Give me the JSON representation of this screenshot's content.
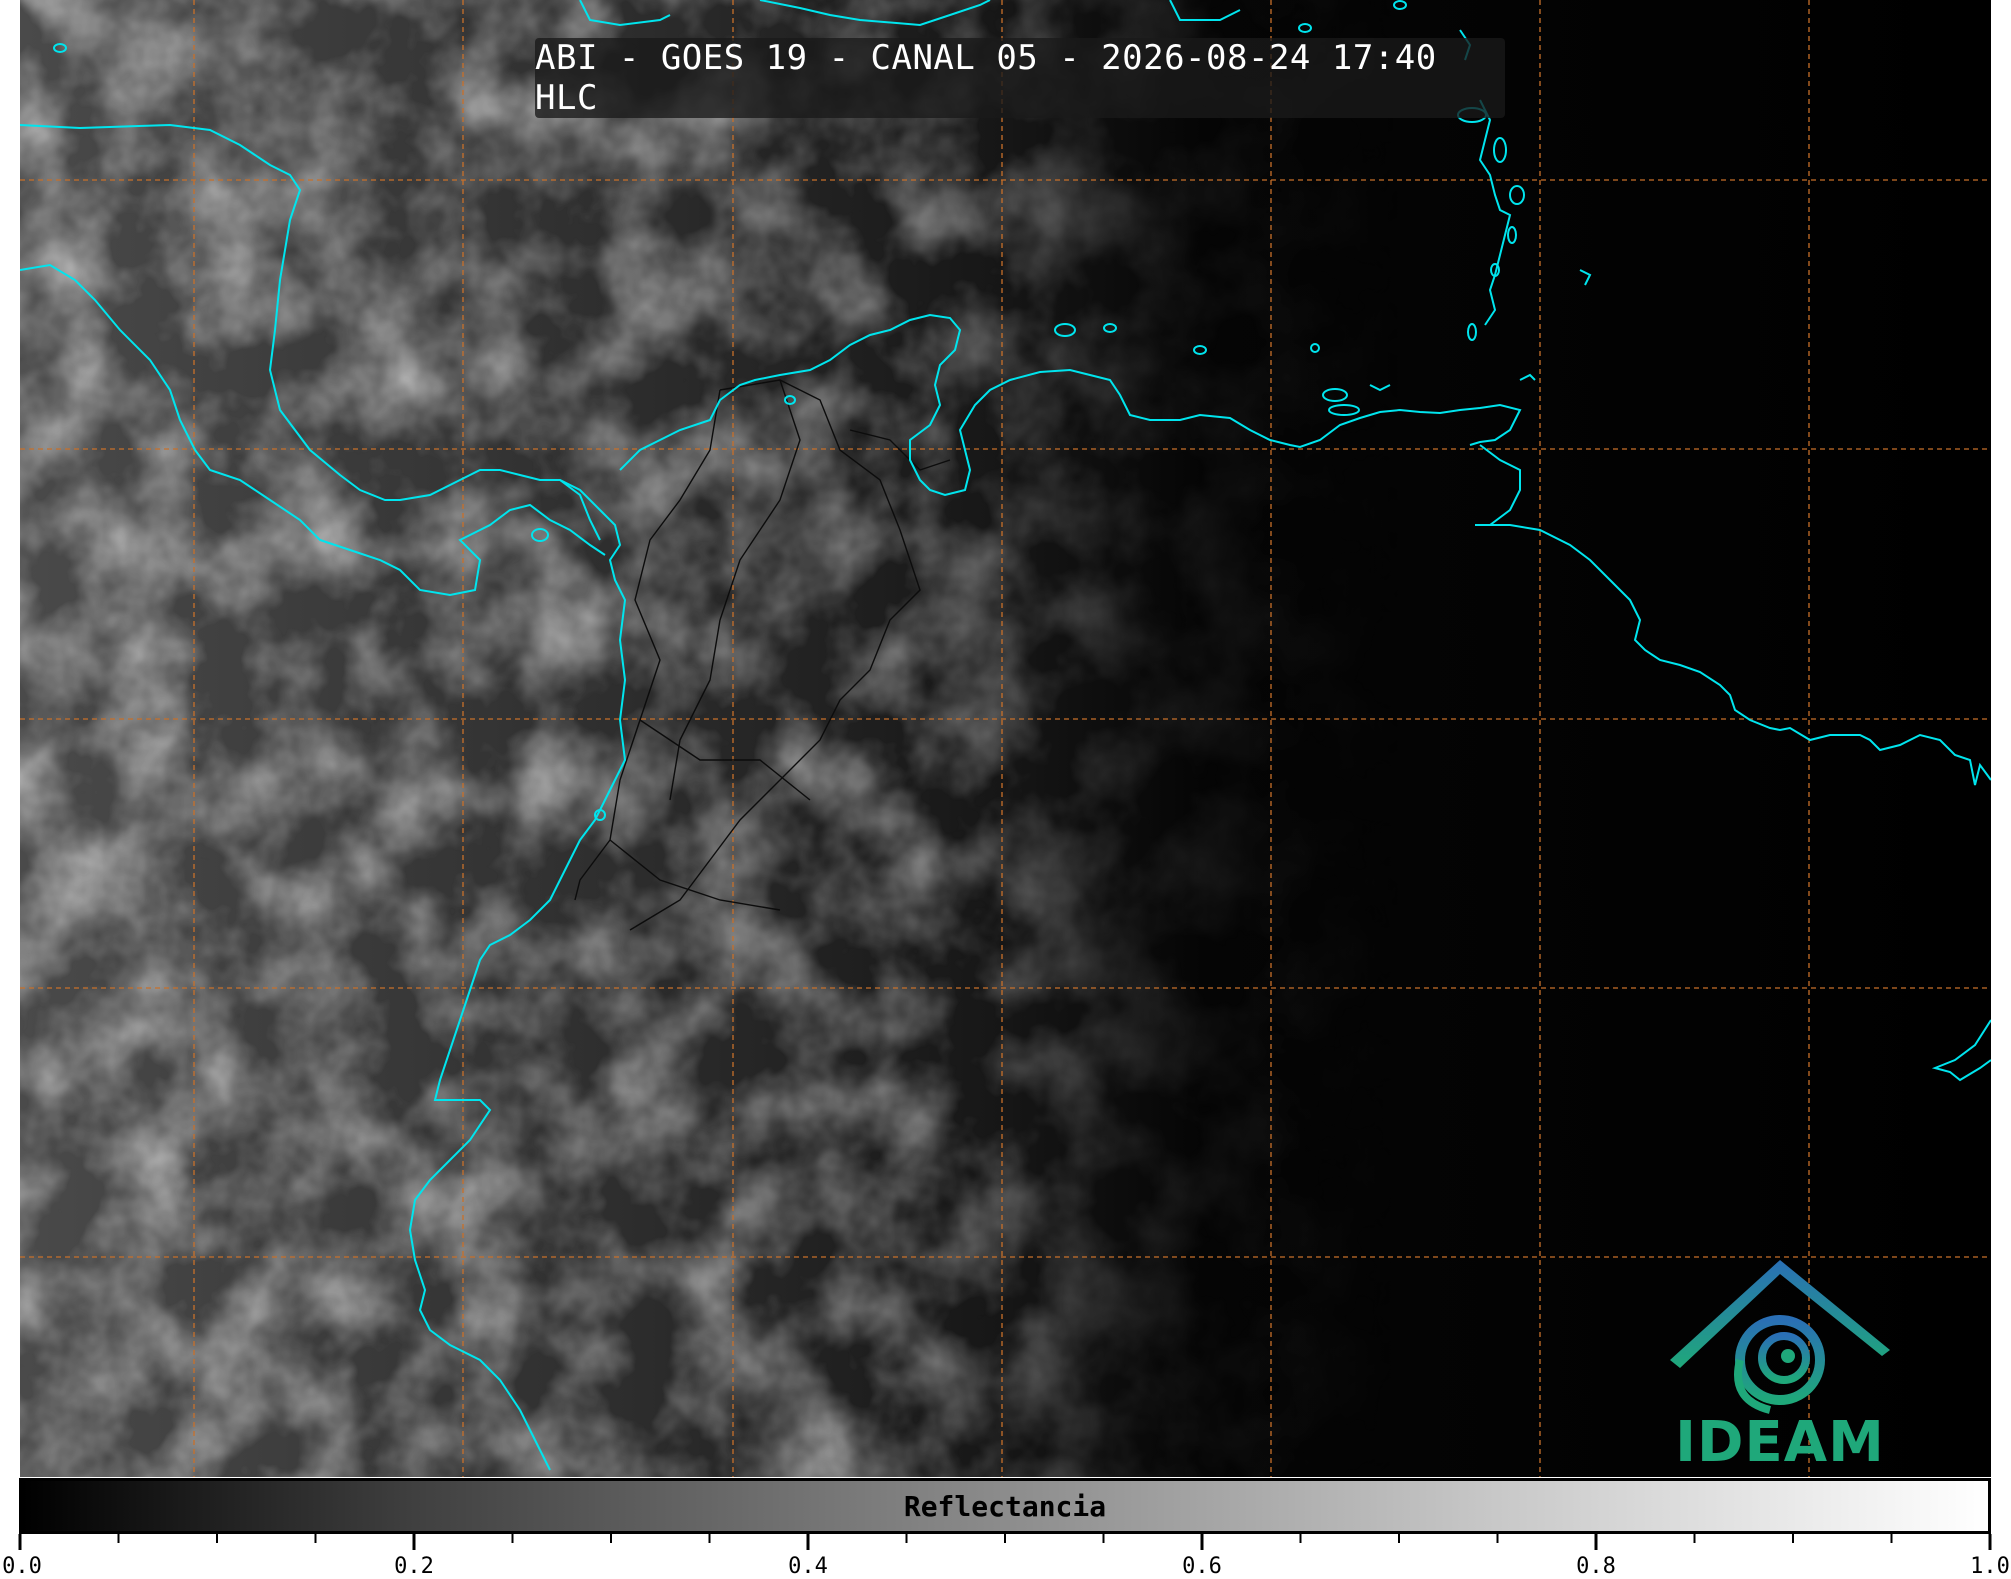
{
  "title": "ABI - GOES 19 - CANAL 05 - 2026-08-24 17:40 HLC",
  "colorbar": {
    "label": "Reflectancia",
    "min": 0.0,
    "max": 1.0,
    "major_ticks": [
      "0.0",
      "0.2",
      "0.4",
      "0.6",
      "0.8",
      "1.0"
    ],
    "minor_tick_step": 0.05,
    "colormap": [
      "#000000",
      "#ffffff"
    ]
  },
  "logo": {
    "text": "IDEAM",
    "colors": [
      "#2a6fb5",
      "#1fa87a"
    ]
  },
  "map": {
    "coastline_color": "#00e5ee",
    "gridline_color": "#c8702a",
    "border_color": "#101010",
    "background": "#000000"
  }
}
